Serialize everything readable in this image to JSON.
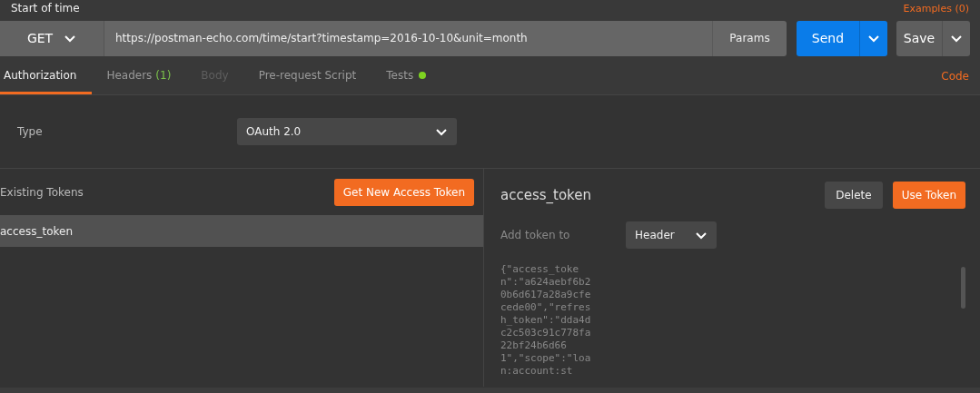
{
  "request": {
    "title": "Start of time",
    "examples": "Examples (0)"
  },
  "url_bar": {
    "method": "GET",
    "url": "https://postman-echo.com/time/start?timestamp=2016-10-10&unit=month",
    "params": "Params",
    "send": "Send",
    "save": "Save"
  },
  "tabs": [
    {
      "label": "Authorization",
      "selected": true,
      "disabled": false
    },
    {
      "label": "Headers",
      "count": "(1)",
      "selected": false,
      "disabled": false
    },
    {
      "label": "Body",
      "selected": false,
      "disabled": true
    },
    {
      "label": "Pre-request Script",
      "selected": false,
      "disabled": false
    },
    {
      "label": "Tests",
      "dot": true,
      "selected": false,
      "disabled": false
    }
  ],
  "code_link": "Code",
  "auth": {
    "type_label": "Type",
    "type_value": "OAuth 2.0"
  },
  "tokens": {
    "heading": "Existing Tokens",
    "get_button": "Get New Access Token",
    "items": [
      {
        "name": "access_token",
        "selected": true
      }
    ]
  },
  "token_detail": {
    "name": "access_token",
    "delete": "Delete",
    "use": "Use Token",
    "add_label": "Add token to",
    "add_value": "Header",
    "value": "{\"access_token\":\"a624aebf6b20b6d617a28a9cfecede00\",\"refresh_token\":\"dda4dc2c503c91c778fa22bf24b6d661\",\"scope\":\"loan:account:st"
  }
}
